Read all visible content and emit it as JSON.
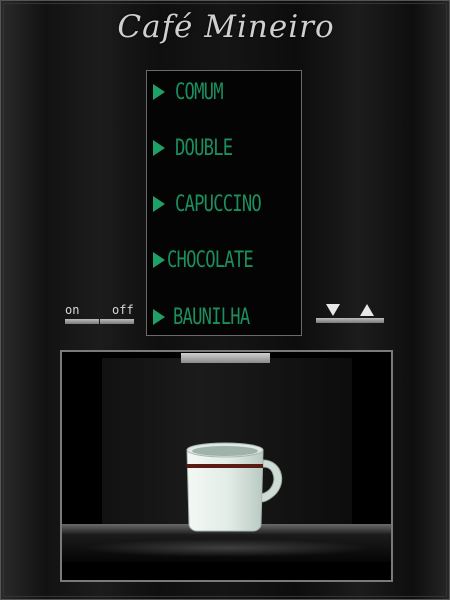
{
  "brand": {
    "name": "Café Mineiro"
  },
  "menu": {
    "items": [
      {
        "label": "COMUM"
      },
      {
        "label": "DOUBLE"
      },
      {
        "label": "CAPUCCINO"
      },
      {
        "label": "CHOCOLATE"
      },
      {
        "label": "BAUNILHA"
      }
    ]
  },
  "power": {
    "on_label": "on",
    "off_label": "off"
  },
  "colors": {
    "display_text": "#1c8f5e",
    "display_arrow": "#1fa066",
    "panel": "#151515",
    "cup_body": "#e6efe9",
    "cup_stripe": "#5a1b12"
  },
  "icons": {
    "menu_pointer": "play-triangle",
    "down": "triangle-down",
    "up": "triangle-up",
    "cup": "coffee-mug"
  }
}
